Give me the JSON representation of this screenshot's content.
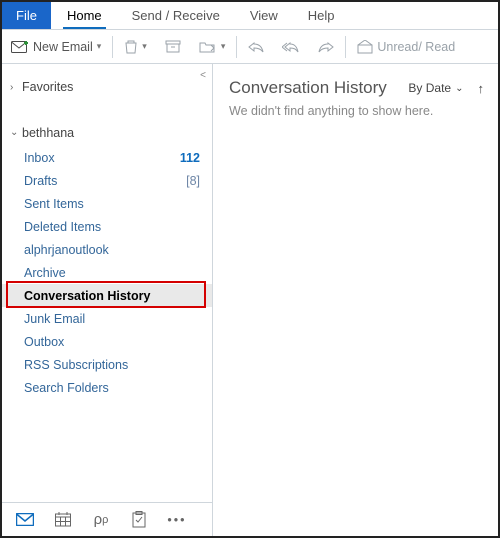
{
  "tabs": {
    "file": "File",
    "home": "Home",
    "sendreceive": "Send / Receive",
    "view": "View",
    "help": "Help"
  },
  "toolbar": {
    "new_email": "New Email",
    "unread_read": "Unread/ Read"
  },
  "sidebar": {
    "favorites": "Favorites",
    "account": "bethhana",
    "folders": [
      {
        "label": "Inbox",
        "count": "112",
        "count_style": "bold"
      },
      {
        "label": "Drafts",
        "count": "[8]",
        "count_style": "bracket"
      },
      {
        "label": "Sent Items"
      },
      {
        "label": "Deleted Items"
      },
      {
        "label": "alphrjanoutlook"
      },
      {
        "label": "Archive"
      },
      {
        "label": "Conversation History",
        "selected": true
      },
      {
        "label": "Junk Email"
      },
      {
        "label": "Outbox"
      },
      {
        "label": "RSS Subscriptions"
      },
      {
        "label": "Search Folders"
      }
    ]
  },
  "reading": {
    "title": "Conversation History",
    "sort": "By Date",
    "empty": "We didn't find anything to show here."
  }
}
